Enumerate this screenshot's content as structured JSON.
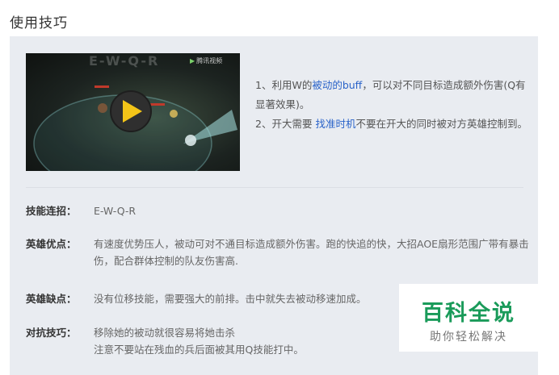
{
  "section": {
    "title": "使用技巧"
  },
  "video": {
    "combo_overlay": "E-W-Q-R",
    "brand": "腾讯视频",
    "colors": {
      "play_fill": "#f3c418",
      "play_ring": "#333333"
    }
  },
  "tips": {
    "line1_prefix": "1、利用W的",
    "line1_highlight": "被动的buff",
    "line1_suffix": "，可以对不同目标造成额外伤害(Q有显著效果)。",
    "line2_prefix": "2、开大需要 ",
    "line2_highlight": "找准时机",
    "line2_suffix": "不要在开大的同时被对方英雄控制到。"
  },
  "rows": [
    {
      "label": "技能连招：",
      "value": "E-W-Q-R"
    },
    {
      "label": "英雄优点：",
      "value": "有速度优势压人，被动可对不通目标造成额外伤害。跑的快追的快，大招AOE扇形范围广带有暴击伤，配合群体控制的队友伤害高."
    },
    {
      "label": "英雄缺点：",
      "value": "没有位移技能，需要强大的前排。击中就失去被动移速加成。"
    },
    {
      "label": "对抗技巧：",
      "value": "移除她的被动就很容易将她击杀",
      "value2": "注意不要站在残血的兵后面被其用Q技能打中。"
    }
  ],
  "watermark": {
    "title": "百科全说",
    "subtitle": "助你轻松解决",
    "color": "#1a9b5a"
  }
}
